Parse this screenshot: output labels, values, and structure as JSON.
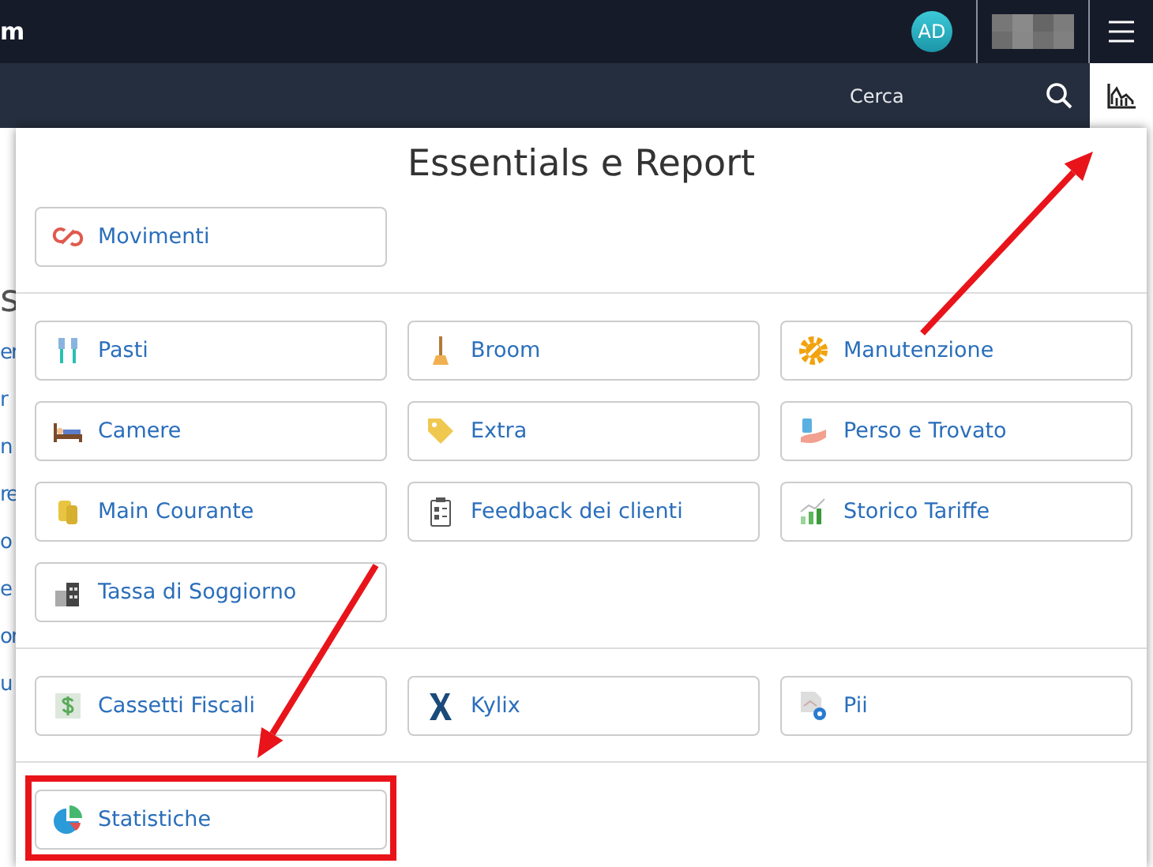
{
  "top_bar": {
    "title": "m",
    "avatar": "AD"
  },
  "search_bar": {
    "label": "Cerca",
    "chart_button": {
      "pointed_at": true
    }
  },
  "background_fragments": [
    "s",
    "er",
    "r",
    "n",
    "re",
    "o",
    "e",
    "or",
    "u"
  ],
  "panel": {
    "title": "Essentials e Report",
    "sections": [
      {
        "items": [
          {
            "label": "Movimenti"
          }
        ]
      },
      {
        "items": [
          {
            "label": "Pasti"
          },
          {
            "label": "Broom"
          },
          {
            "label": "Manutenzione"
          },
          {
            "label": "Camere"
          },
          {
            "label": "Extra"
          },
          {
            "label": "Perso e Trovato"
          },
          {
            "label": "Main Courante"
          },
          {
            "label": "Feedback dei clienti"
          },
          {
            "label": "Storico Tariffe"
          },
          {
            "label": "Tassa di Soggiorno"
          }
        ]
      },
      {
        "items": [
          {
            "label": "Cassetti Fiscali"
          },
          {
            "label": "Kylix"
          },
          {
            "label": "Pii"
          }
        ]
      },
      {
        "items": [
          {
            "label": "Statistiche",
            "pointed_at": true,
            "highlighted": true
          }
        ]
      }
    ]
  }
}
